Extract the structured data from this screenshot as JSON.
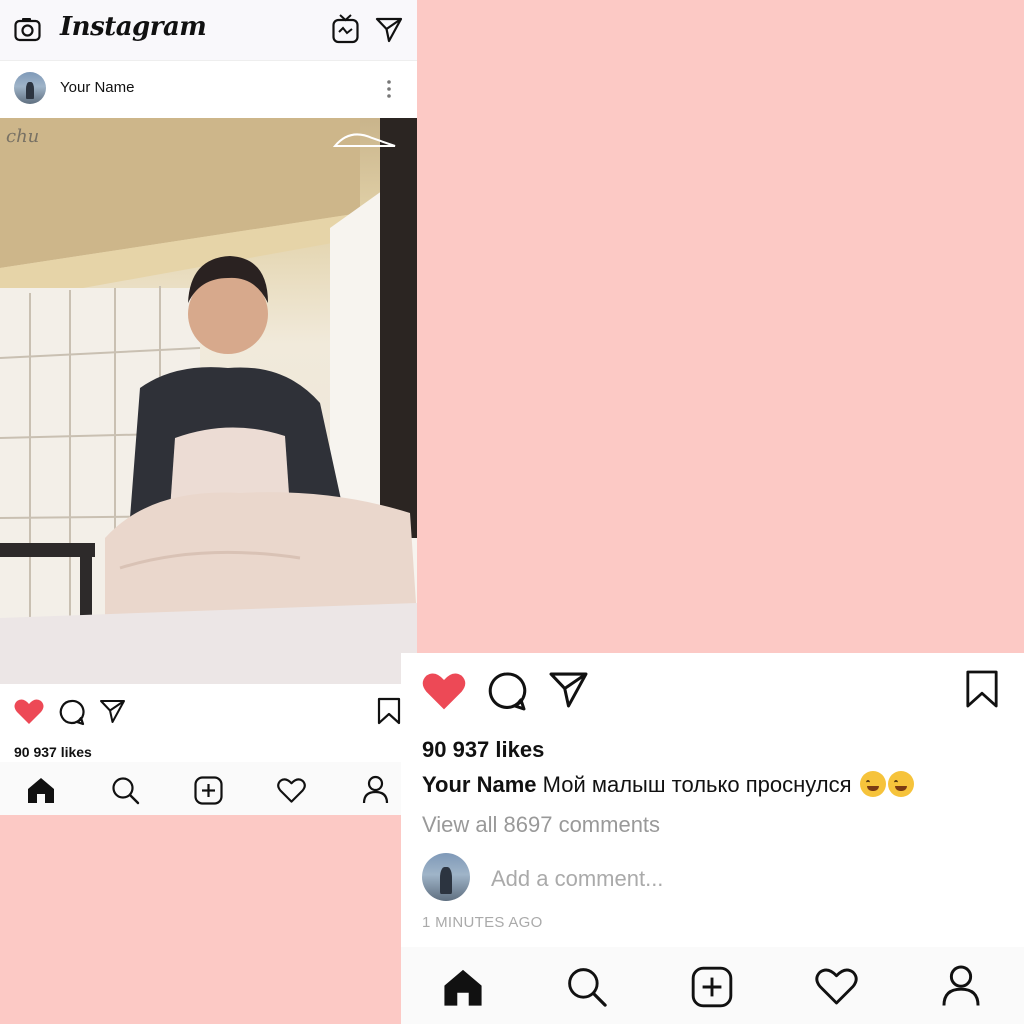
{
  "app": {
    "brand": "Instagram"
  },
  "post": {
    "username": "Your Name",
    "likes": "90 937 likes",
    "caption": "Мой малыш только проснулся",
    "view_comments": "View all 8697 comments",
    "comment_placeholder": "Add a comment...",
    "time_ago": "1 MINUTES AGO",
    "liked": true
  },
  "photo": {
    "watermark": "chu"
  },
  "icons": {
    "camera": "camera-icon",
    "igtv": "igtv-icon",
    "direct": "direct-message-icon",
    "more": "more-options-icon",
    "like": "heart-filled-icon",
    "comment": "comment-icon",
    "share": "share-icon",
    "save": "bookmark-icon",
    "home": "home-icon",
    "search": "search-icon",
    "add": "add-post-icon",
    "activity": "heart-outline-icon",
    "profile": "profile-icon"
  },
  "colors": {
    "like_red": "#ed4956",
    "background_pink": "#fcc9c5"
  }
}
